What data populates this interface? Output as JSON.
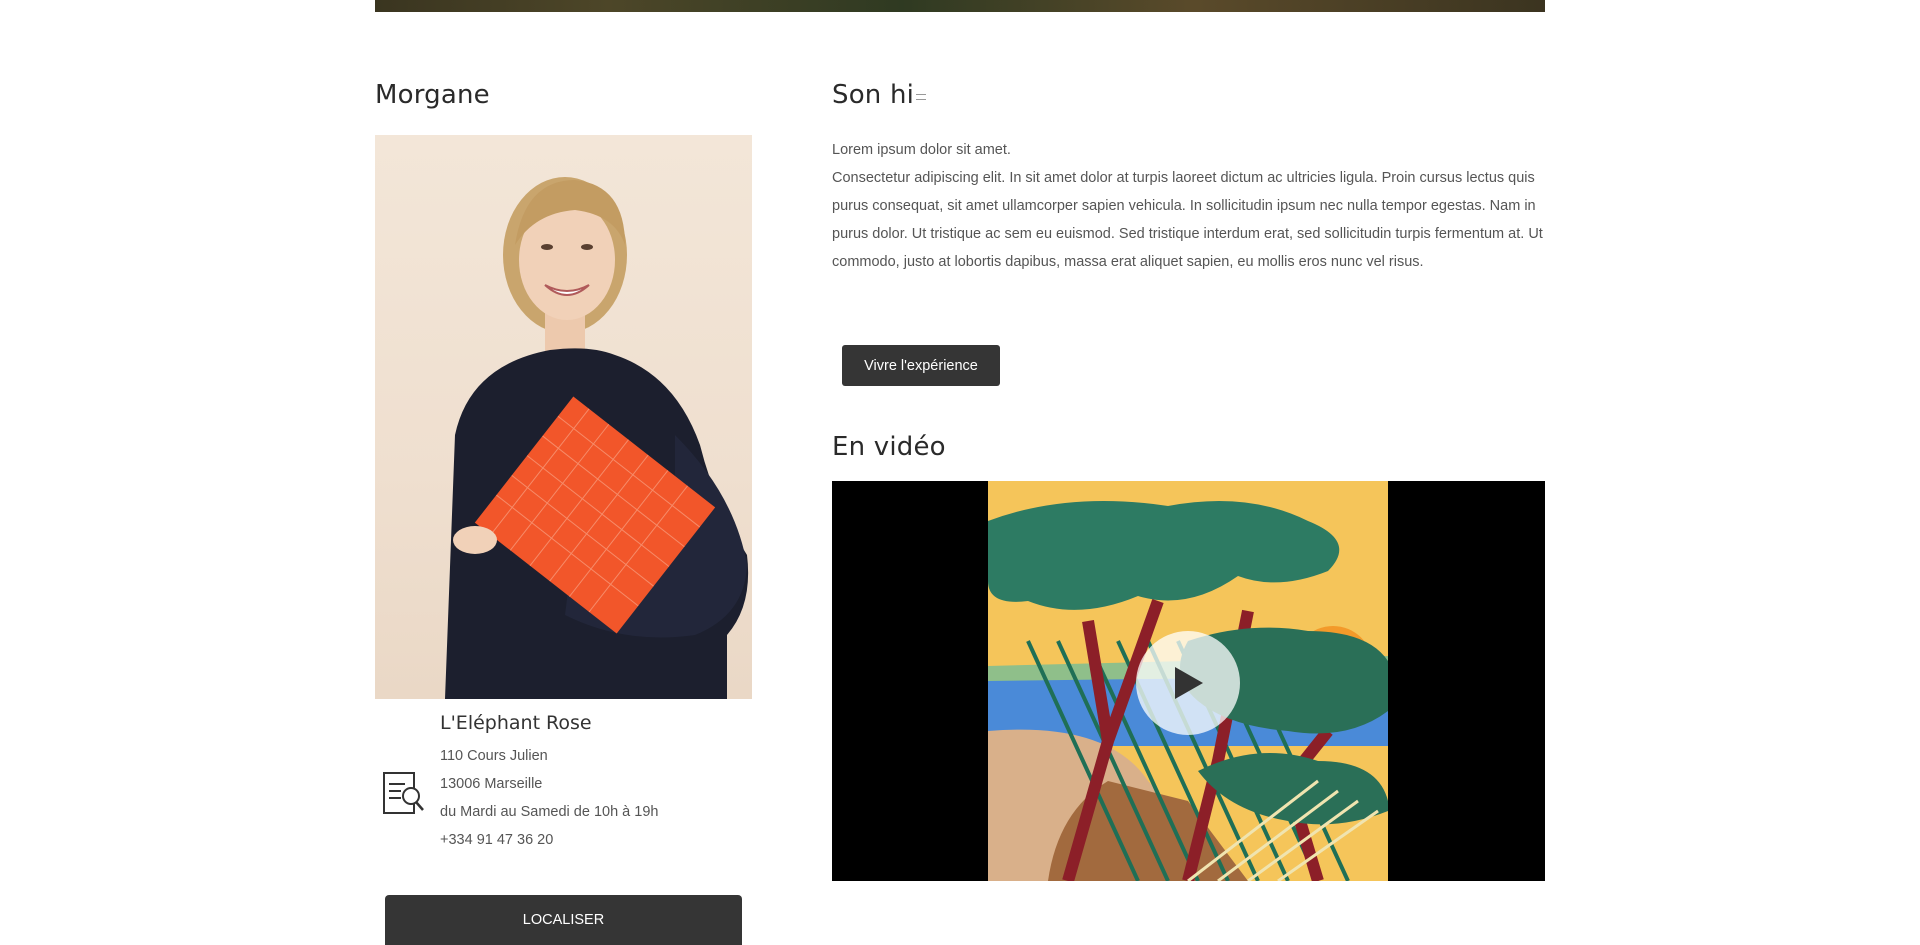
{
  "profile": {
    "name": "Morgane"
  },
  "shop": {
    "name": "L'Eléphant Rose",
    "address_line1": "110 Cours Julien",
    "address_line2": "13006 Marseille",
    "hours": "du Mardi au Samedi de 10h à 19h",
    "phone": "+334 91 47 36 20",
    "locate_label": "LOCALISER",
    "icon": "document-search-icon"
  },
  "story": {
    "title": "Son hi",
    "line1": "Lorem ipsum dolor sit amet.",
    "paragraph": "Consectetur adipiscing elit. In sit amet dolor at turpis laoreet dictum ac ultricies ligula. Proin cursus lectus quis purus consequat, sit amet ullamcorper sapien vehicula. In sollicitudin ipsum nec nulla tempor egestas. Nam in purus dolor. Ut tristique ac sem eu euismod. Sed tristique interdum erat, sed sollicitudin turpis fermentum at. Ut commodo, justo at lobortis dapibus, massa erat aliquet sapien, eu mollis eros nunc vel risus.",
    "cta_label": "Vivre l'expérience"
  },
  "video": {
    "title": "En vidéo",
    "play_icon": "play-icon"
  },
  "colors": {
    "button_bg": "#353535",
    "text": "#555555",
    "heading": "#2a2a2a"
  }
}
